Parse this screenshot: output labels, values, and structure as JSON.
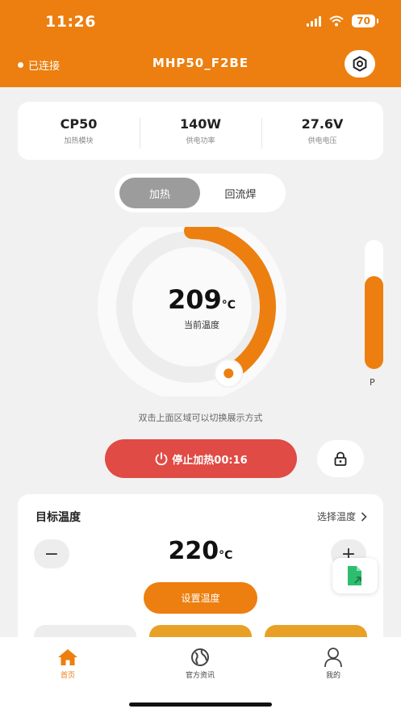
{
  "status_bar": {
    "time": "11:26",
    "battery": "70"
  },
  "header": {
    "connection_status": "已连接",
    "device_name": "MHP50_F2BE"
  },
  "info": [
    {
      "value": "CP50",
      "label": "加热模块"
    },
    {
      "value": "140W",
      "label": "供电功率"
    },
    {
      "value": "27.6V",
      "label": "供电电压"
    }
  ],
  "modes": {
    "active": "加热",
    "inactive": "回流焊"
  },
  "dial": {
    "temperature": "209",
    "unit": "°C",
    "label": "当前温度",
    "arc_fraction": 0.42
  },
  "power": {
    "label": "P",
    "fill_fraction": 0.72
  },
  "hint": "双击上面区域可以切换展示方式",
  "stop_button": {
    "label": "停止加热00:16"
  },
  "target": {
    "title": "目标温度",
    "select_label": "选择温度",
    "value": "220",
    "unit": "°C",
    "minus": "−",
    "plus": "+",
    "set_label": "设置温度"
  },
  "tabs": [
    {
      "label": "首页",
      "icon": "home-icon"
    },
    {
      "label": "官方资讯",
      "icon": "globe-icon"
    },
    {
      "label": "我的",
      "icon": "user-icon"
    }
  ],
  "colors": {
    "accent": "#ec7f0f",
    "stop": "#e04b45",
    "mode_active": "#9c9c9c"
  }
}
